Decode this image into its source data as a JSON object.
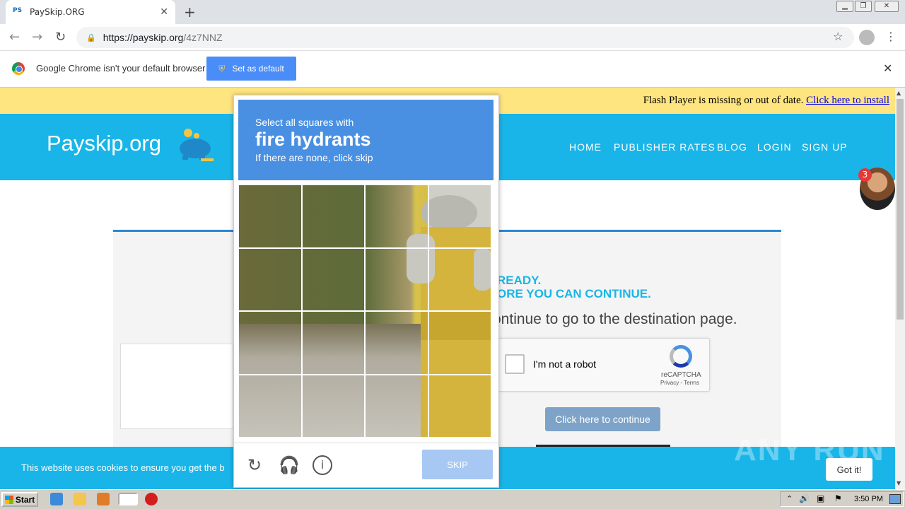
{
  "browser": {
    "tab_title": "PaySkip.ORG",
    "tab_favicon": "PS",
    "url_host": "https://payskip.org",
    "url_path": "/4z7NNZ",
    "infobar_text": "Google Chrome isn't your default browser",
    "set_default_label": "Set as default"
  },
  "page": {
    "flash_text": "Flash Player is missing or out of date.",
    "flash_link": "Click here to install",
    "logo_text": "Payskip.org",
    "nav": [
      "HOME",
      "PUBLISHER RATES",
      "BLOG",
      "LOGIN",
      "SIGN UP"
    ],
    "badge_count": "3",
    "ready_line1": "READY.",
    "ready_line2": "ORE YOU CAN CONTINUE.",
    "continue_text": "ontinue to go to the destination page.",
    "recaptcha_label": "I'm not a robot",
    "recaptcha_brand": "reCAPTCHA",
    "recaptcha_links": "Privacy - Terms",
    "continue_button": "Click here to continue",
    "cookie_text": "This website uses cookies to ensure you get the b",
    "cookie_button": "Got it!",
    "watermark": "ANY RUN"
  },
  "challenge": {
    "line1": "Select all squares with",
    "line2": "fire hydrants",
    "line3": "If there are none, click skip",
    "skip_label": "SKIP",
    "footer_icons": [
      "reload-icon",
      "audio-icon",
      "info-icon"
    ]
  },
  "taskbar": {
    "start_label": "Start",
    "clock": "3:50 PM"
  },
  "colors": {
    "site_blue": "#19b5e8",
    "challenge_blue": "#4a90e2",
    "flash_yellow": "#ffe57f"
  }
}
